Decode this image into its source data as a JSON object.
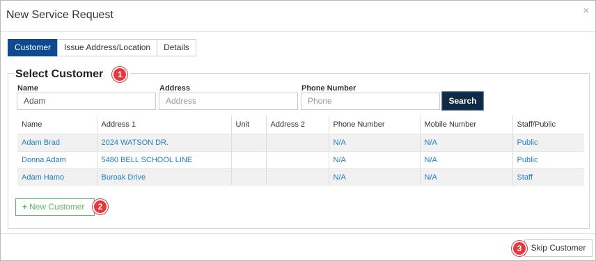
{
  "dialog": {
    "title": "New Service Request",
    "close_icon": "×"
  },
  "tabs": [
    {
      "label": "Customer",
      "active": true
    },
    {
      "label": "Issue Address/Location",
      "active": false
    },
    {
      "label": "Details",
      "active": false
    }
  ],
  "select_customer": {
    "legend": "Select Customer",
    "callout": "1",
    "fields": {
      "name": {
        "label": "Name",
        "value": "Adam",
        "placeholder": ""
      },
      "address": {
        "label": "Address",
        "value": "",
        "placeholder": "Address"
      },
      "phone": {
        "label": "Phone Number",
        "value": "",
        "placeholder": "Phone"
      }
    },
    "search_label": "Search",
    "table": {
      "columns": [
        "Name",
        "Address 1",
        "Unit",
        "Address 2",
        "Phone Number",
        "Mobile Number",
        "Staff/Public"
      ],
      "rows": [
        [
          "Adam Brad",
          "2024 WATSON DR.",
          "",
          "",
          "N/A",
          "N/A",
          "Public"
        ],
        [
          "Donna Adam",
          "5480 BELL SCHOOL LINE",
          "",
          "",
          "N/A",
          "N/A",
          "Public"
        ],
        [
          "Adam Hamo",
          "Buroak Drive",
          "",
          "",
          "N/A",
          "N/A",
          "Staff"
        ]
      ]
    },
    "new_customer_label": "New Customer",
    "new_customer_icon": "+",
    "new_customer_callout": "2"
  },
  "footer": {
    "skip_label": "Skip Customer",
    "skip_callout": "3"
  },
  "colors": {
    "active_tab": "#0d4a8f",
    "search_button": "#0f2a45",
    "link": "#1f7fbf",
    "new_customer_green": "#5cb85c",
    "callout_red": "#e8363c"
  }
}
